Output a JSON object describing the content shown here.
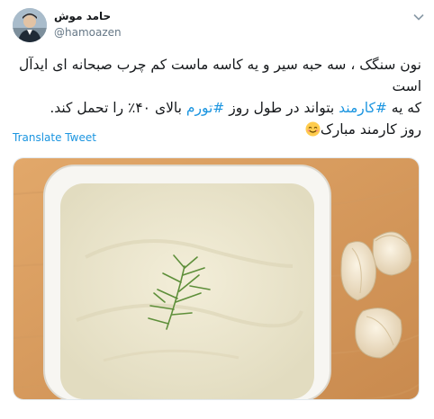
{
  "tweet": {
    "author_name": "حامد موش",
    "author_handle": "@hamoazen",
    "text_line1": "نون سنگک ، سه حبه سیر و یه کاسه ماست کم چرب صبحانه ای ایدآل است",
    "text_line2_part1": "که یه ",
    "hashtag1": "#کارمند",
    "text_line2_part2": " بتواند در طول روز ",
    "hashtag2": "#تورم",
    "text_line2_part3": " بالای ۴۰٪ را تحمل کند.",
    "text_line3": "روز کارمند مبارک",
    "translate_label": "Translate Tweet",
    "emoji_icon": "smiling-face-emoji",
    "menu_icon": "chevron-down-icon"
  },
  "colors": {
    "link": "#1b95e0",
    "text": "#14171a",
    "muted": "#657786"
  }
}
